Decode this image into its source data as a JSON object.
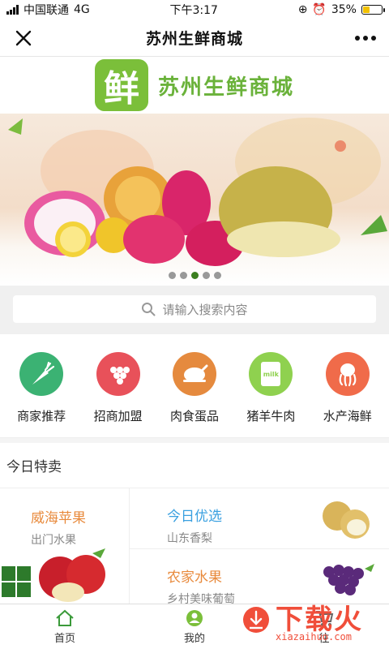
{
  "status": {
    "carrier": "中国联通",
    "network": "4G",
    "time": "下午3:17",
    "battery": "35%",
    "battery_level": 0.35
  },
  "nav": {
    "title": "苏州生鲜商城",
    "close_icon": "close-icon",
    "more_icon": "more-icon"
  },
  "logo": {
    "glyph": "鲜",
    "text": "苏州生鲜商城"
  },
  "banner": {
    "slide_count": 5,
    "active_index": 2
  },
  "search": {
    "placeholder": "请输入搜索内容"
  },
  "categories": [
    {
      "label": "商家推荐",
      "color": "#3bb273",
      "icon": "carrot-icon"
    },
    {
      "label": "招商加盟",
      "color": "#e8515a",
      "icon": "grapes-icon"
    },
    {
      "label": "肉食蛋品",
      "color": "#e58a3e",
      "icon": "chicken-icon"
    },
    {
      "label": "猪羊牛肉",
      "color": "#8fd14f",
      "icon": "milk-icon",
      "icon_text": "milk"
    },
    {
      "label": "水产海鲜",
      "color": "#f06b4a",
      "icon": "octopus-icon"
    }
  ],
  "section": {
    "title": "今日特卖"
  },
  "specials": [
    {
      "title": "威海苹果",
      "subtitle": "出门水果",
      "color": "#e88a3c"
    },
    {
      "title": "今日优选",
      "subtitle": "山东香梨",
      "color": "#3aa0e0"
    },
    {
      "title": "农家水果",
      "subtitle": "乡村美味葡萄",
      "color": "#e88a3c"
    }
  ],
  "tabs": [
    {
      "label": "首页",
      "icon": "home-icon"
    },
    {
      "label": "我的",
      "icon": "user-icon"
    },
    {
      "label": "往",
      "icon": "cart-icon"
    }
  ],
  "watermark": {
    "text": "下载火",
    "domain": "xiazaihuo.com"
  },
  "colors": {
    "brand_green": "#7bbf3a",
    "active_dot": "#3b7f1f"
  }
}
